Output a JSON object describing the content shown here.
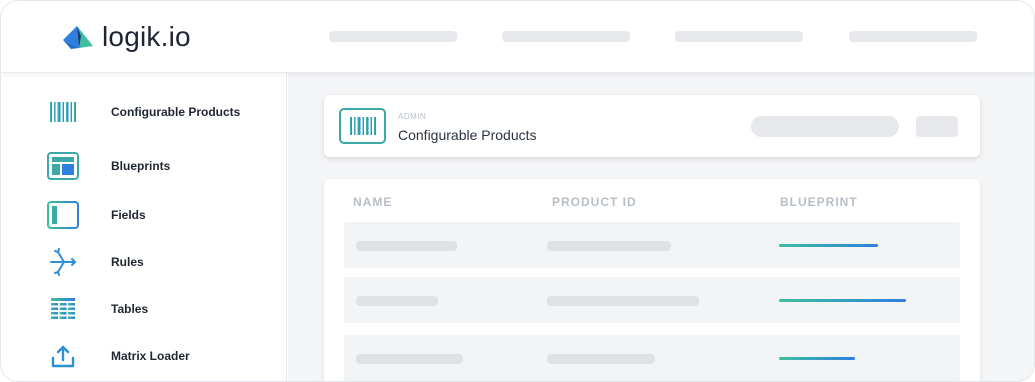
{
  "brand": {
    "name": "logik.io",
    "colors": {
      "teal": "#3aa9a7",
      "blue": "#2f7fe0",
      "green": "#3dbf9e",
      "navy": "#1d2433"
    }
  },
  "sidebar": {
    "items": [
      {
        "label": "Configurable Products",
        "icon": "barcode-icon"
      },
      {
        "label": "Blueprints",
        "icon": "blueprint-icon"
      },
      {
        "label": "Fields",
        "icon": "field-icon"
      },
      {
        "label": "Rules",
        "icon": "rules-icon"
      },
      {
        "label": "Tables",
        "icon": "table-icon"
      },
      {
        "label": "Matrix Loader",
        "icon": "upload-icon"
      }
    ]
  },
  "header": {
    "breadcrumb": "ADMIN",
    "title": "Configurable Products",
    "icon": "barcode-icon"
  },
  "table": {
    "columns": [
      "NAME",
      "PRODUCT ID",
      "BLUEPRINT"
    ],
    "rows": [
      {
        "blueprint_progress": 0.78
      },
      {
        "blueprint_progress": 1.0
      },
      {
        "blueprint_progress": 0.6
      }
    ]
  }
}
